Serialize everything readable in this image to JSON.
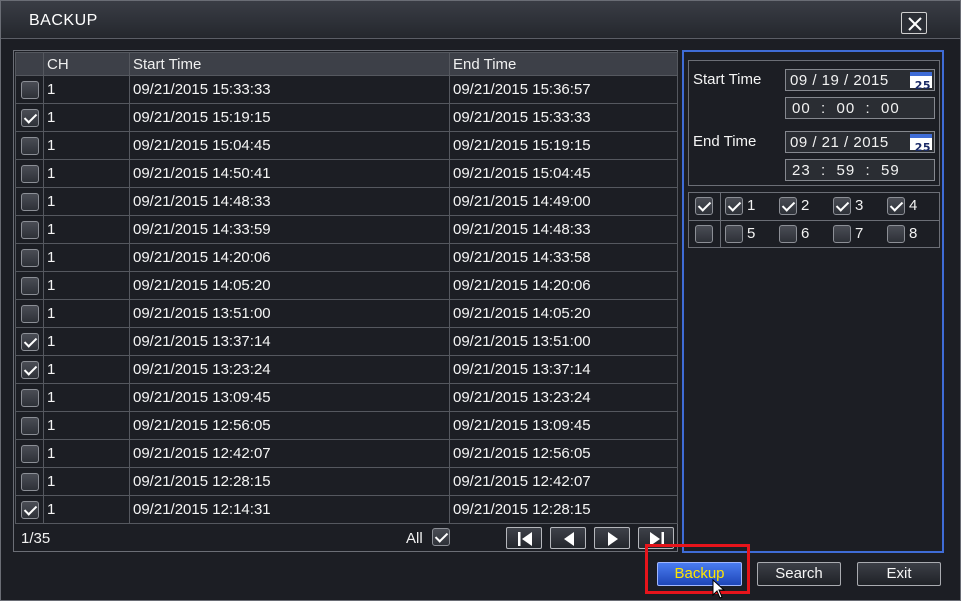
{
  "window": {
    "title": "BACKUP"
  },
  "table": {
    "headers": [
      "CH",
      "Start Time",
      "End Time"
    ],
    "rows": [
      {
        "checked": false,
        "ch": "1",
        "start": "09/21/2015 15:33:33",
        "end": "09/21/2015 15:36:57"
      },
      {
        "checked": true,
        "ch": "1",
        "start": "09/21/2015 15:19:15",
        "end": "09/21/2015 15:33:33"
      },
      {
        "checked": false,
        "ch": "1",
        "start": "09/21/2015 15:04:45",
        "end": "09/21/2015 15:19:15"
      },
      {
        "checked": false,
        "ch": "1",
        "start": "09/21/2015 14:50:41",
        "end": "09/21/2015 15:04:45"
      },
      {
        "checked": false,
        "ch": "1",
        "start": "09/21/2015 14:48:33",
        "end": "09/21/2015 14:49:00"
      },
      {
        "checked": false,
        "ch": "1",
        "start": "09/21/2015 14:33:59",
        "end": "09/21/2015 14:48:33"
      },
      {
        "checked": false,
        "ch": "1",
        "start": "09/21/2015 14:20:06",
        "end": "09/21/2015 14:33:58"
      },
      {
        "checked": false,
        "ch": "1",
        "start": "09/21/2015 14:05:20",
        "end": "09/21/2015 14:20:06"
      },
      {
        "checked": false,
        "ch": "1",
        "start": "09/21/2015 13:51:00",
        "end": "09/21/2015 14:05:20"
      },
      {
        "checked": true,
        "ch": "1",
        "start": "09/21/2015 13:37:14",
        "end": "09/21/2015 13:51:00"
      },
      {
        "checked": true,
        "ch": "1",
        "start": "09/21/2015 13:23:24",
        "end": "09/21/2015 13:37:14"
      },
      {
        "checked": false,
        "ch": "1",
        "start": "09/21/2015 13:09:45",
        "end": "09/21/2015 13:23:24"
      },
      {
        "checked": false,
        "ch": "1",
        "start": "09/21/2015 12:56:05",
        "end": "09/21/2015 13:09:45"
      },
      {
        "checked": false,
        "ch": "1",
        "start": "09/21/2015 12:42:07",
        "end": "09/21/2015 12:56:05"
      },
      {
        "checked": false,
        "ch": "1",
        "start": "09/21/2015 12:28:15",
        "end": "09/21/2015 12:42:07"
      },
      {
        "checked": true,
        "ch": "1",
        "start": "09/21/2015 12:14:31",
        "end": "09/21/2015 12:28:15"
      }
    ],
    "page_indicator": "1/35",
    "all_label": "All",
    "all_checked": true,
    "nav_icons": [
      "first-page-icon",
      "prev-page-icon",
      "next-page-icon",
      "last-page-icon"
    ]
  },
  "filter": {
    "start_label": "Start Time",
    "start_date": "09 / 19 / 2015",
    "start_time": "00  :  00  :  00",
    "end_label": "End Time",
    "end_date": "09 / 21 / 2015",
    "end_time": "23  :  59  :  59",
    "calendar_icon_text": "25",
    "all_channels_checked": true,
    "channels": [
      {
        "label": "1",
        "checked": true
      },
      {
        "label": "2",
        "checked": true
      },
      {
        "label": "3",
        "checked": true
      },
      {
        "label": "4",
        "checked": true
      },
      {
        "label": "5",
        "checked": false
      },
      {
        "label": "6",
        "checked": false
      },
      {
        "label": "7",
        "checked": false
      },
      {
        "label": "8",
        "checked": false
      }
    ]
  },
  "buttons": {
    "backup": "Backup",
    "search": "Search",
    "exit": "Exit"
  },
  "colors": {
    "accent": "#3f6cd6",
    "highlight": "#e6141b",
    "primary_text": "#ffe600"
  }
}
